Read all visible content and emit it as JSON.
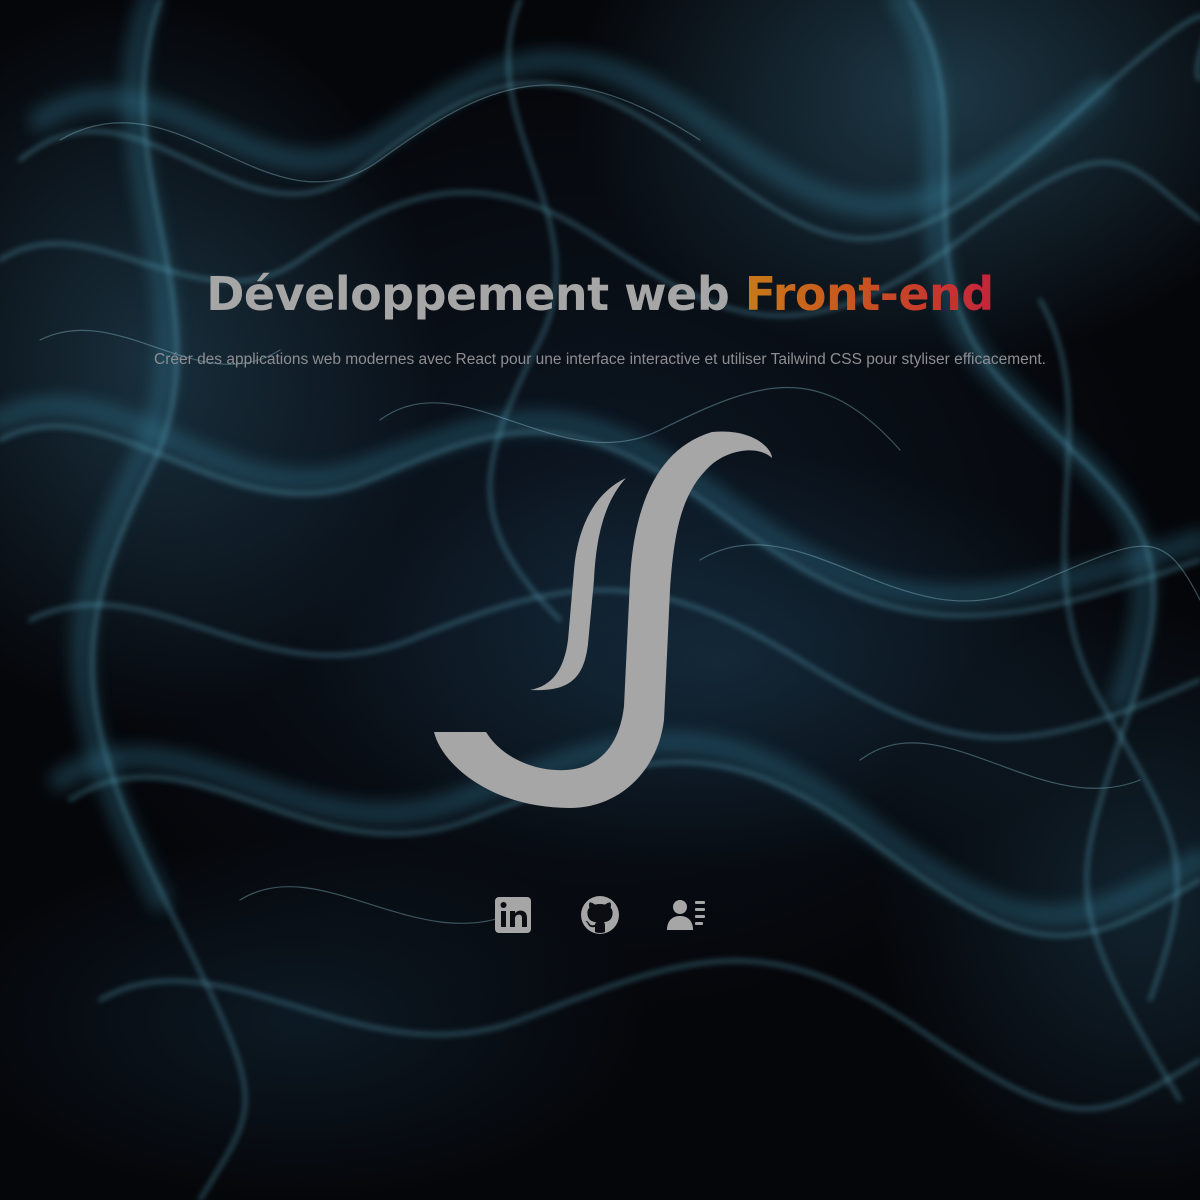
{
  "hero": {
    "title_main": "Développement web ",
    "title_accent": "Front-end",
    "subtitle": "Créer des applications web modernes avec React pour une interface interactive et utiliser Tailwind CSS pour styliser efficacement."
  },
  "logo": {
    "icon": "js-monogram-logo"
  },
  "social": {
    "links": [
      {
        "icon": "linkedin-icon",
        "label": "LinkedIn"
      },
      {
        "icon": "github-icon",
        "label": "GitHub"
      },
      {
        "icon": "resume-contact-card-icon",
        "label": "CV"
      }
    ]
  },
  "colors": {
    "background": "#07080d",
    "smoke": "#5fb4cf",
    "text": "#a6a6a6",
    "subtitle": "#8e8e92",
    "accent_start": "#c77a1a",
    "accent_end": "#c4243a"
  }
}
